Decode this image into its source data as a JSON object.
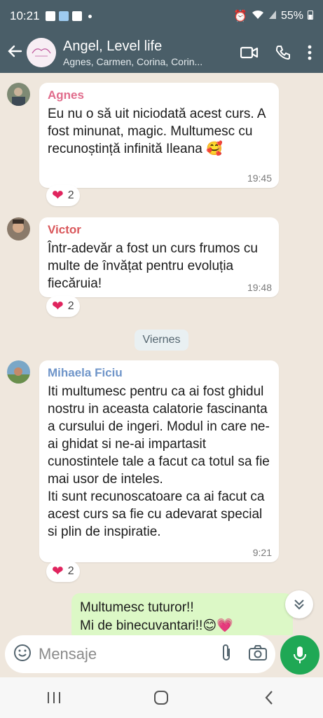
{
  "status": {
    "time": "10:21",
    "battery": "55%"
  },
  "header": {
    "title": "Angel, Level life",
    "subtitle": "Agnes, Carmen, Corina, Corin..."
  },
  "messages": [
    {
      "sender": "Agnes",
      "sender_color": "#e06b8b",
      "text": "Eu nu o să uit niciodată acest curs. A fost minunat, magic. Multumesc cu recunoștință infinită Ileana 🥰",
      "time": "19:45",
      "reaction_count": "2"
    },
    {
      "sender": "Victor",
      "sender_color": "#d9575b",
      "text": "Într-adevăr a fost un curs frumos cu multe de învățat pentru evoluția fiecăruia!",
      "time": "19:48",
      "reaction_count": "2"
    },
    {
      "sender": "Mihaela Ficiu",
      "sender_color": "#6f95c9",
      "text": "Iti multumesc pentru ca ai fost ghidul nostru in aceasta calatorie fascinanta a cursului de ingeri. Modul in care ne-ai ghidat si ne-ai impartasit cunostintele tale a facut ca totul sa fie mai usor de inteles.\nIti sunt recunoscatoare ca ai facut ca acest curs sa fie cu adevarat special si plin de inspiratie.",
      "time": "9:21",
      "reaction_count": "2"
    }
  ],
  "day_divider": "Viernes",
  "outgoing": {
    "text": "Multumesc tuturor!!\nMi de binecuvantari!!😊💗"
  },
  "input": {
    "placeholder": "Mensaje"
  },
  "icons": {
    "back": "arrow-left-icon",
    "video": "video-call-icon",
    "phone": "phone-icon",
    "menu": "more-vert-icon",
    "emoji": "emoji-icon",
    "attach": "paperclip-icon",
    "camera": "camera-icon",
    "mic": "mic-icon",
    "heart": "heart-icon"
  },
  "colors": {
    "header": "#4a5e68",
    "mic": "#1fa855",
    "outgoing": "#dcf8c6"
  }
}
